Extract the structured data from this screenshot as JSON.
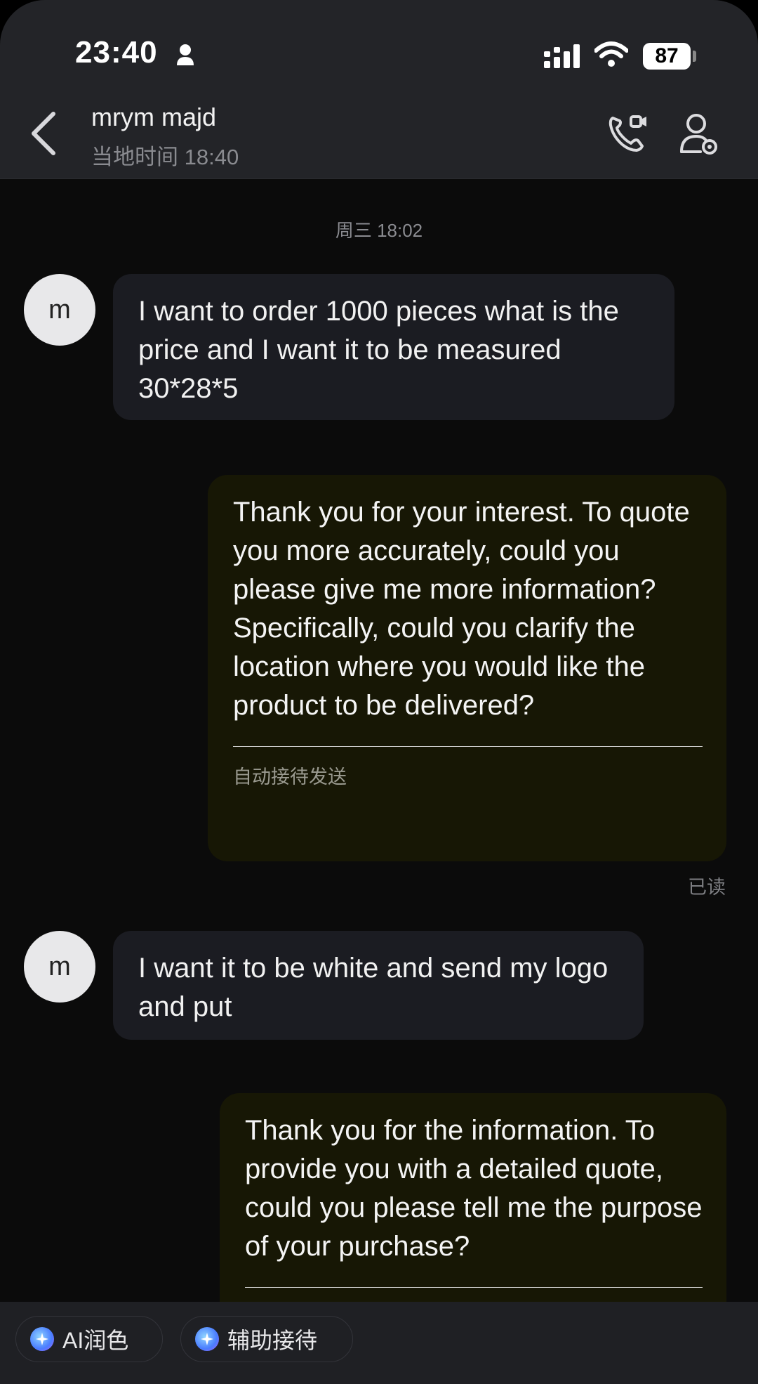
{
  "status_bar": {
    "time": "23:40",
    "battery": "87"
  },
  "header": {
    "name": "mrym majd",
    "local_time": "当地时间 18:40"
  },
  "chat": {
    "date_label": "周三 18:02",
    "avatar_letter": "m",
    "messages": [
      {
        "from": "them",
        "text": "I want to order 1000 pieces what is the price and I want it to be measured 30*28*5"
      },
      {
        "from": "me",
        "text": "Thank you for your interest. To quote you more accurately, could you please give me more information? Specifically, could you clarify the location where you would like the product to be delivered?",
        "note": "自动接待发送",
        "status": "已读"
      },
      {
        "from": "them",
        "text": "I want it to be white and send my logo and put"
      },
      {
        "from": "me",
        "text": "Thank you for the information. To provide you with a detailed quote, could you please tell me the purpose of your purchase?"
      }
    ]
  },
  "bottom_bar": {
    "ai_polish": "AI润色",
    "assist": "辅助接待"
  }
}
